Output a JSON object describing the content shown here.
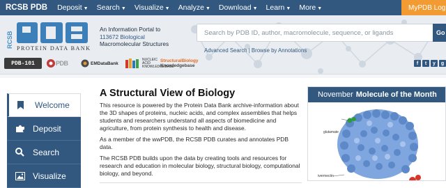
{
  "topnav": {
    "brand": "RCSB PDB",
    "menus": [
      "Deposit",
      "Search",
      "Visualize",
      "Analyze",
      "Download",
      "Learn",
      "More"
    ],
    "login": "MyPDB Login"
  },
  "header": {
    "logo_text": "PROTEIN DATA BANK",
    "logo_side": "RCSB",
    "tagline_1": "An Information Portal to",
    "tagline_count": "113672 Biological",
    "tagline_2": "Macromolecular Structures",
    "search_placeholder": "Search by PDB ID, author, macromolecule, sequence, or ligands",
    "go_label": "Go",
    "advanced_search": "Advanced Search",
    "browse_annotations": "Browse by Annotations",
    "link_separator": " | ",
    "partners": {
      "pdb101": "PDB-101",
      "pdbe": "PDB",
      "emdb": "EMDataBank",
      "nakb": "NUCLEIC ACID KNOWLEDGEBASE",
      "sbkb_1": "StructuralBiology",
      "sbkb_2": "Knowledgebase"
    },
    "social": [
      "f",
      "t",
      "y",
      "g"
    ]
  },
  "sidebar": {
    "items": [
      {
        "label": "Welcome",
        "icon": "bookmark-icon"
      },
      {
        "label": "Deposit",
        "icon": "puzzle-icon"
      },
      {
        "label": "Search",
        "icon": "search-icon"
      },
      {
        "label": "Visualize",
        "icon": "image-icon"
      }
    ]
  },
  "main": {
    "title": "A Structural View of Biology",
    "p1": "This resource is powered by the Protein Data Bank archive-information about the 3D shapes of proteins, nucleic acids, and complex assemblies that helps students and researchers understand all aspects of biomedicine and agriculture, from protein synthesis to health and disease.",
    "p2": "As a member of the wwPDB, the RCSB PDB curates and annotates PDB data.",
    "p3": "The RCSB PDB builds upon the data by creating tools and resources for research and education in molecular biology, structural biology, computational biology, and beyond."
  },
  "motm": {
    "month": "November",
    "title": "Molecule of the Month",
    "label_top": "glutamate",
    "label_bottom": "ivermectin"
  },
  "colors": {
    "navy": "#325880",
    "orange": "#f29b32",
    "header_bg": "#e9edf1"
  }
}
